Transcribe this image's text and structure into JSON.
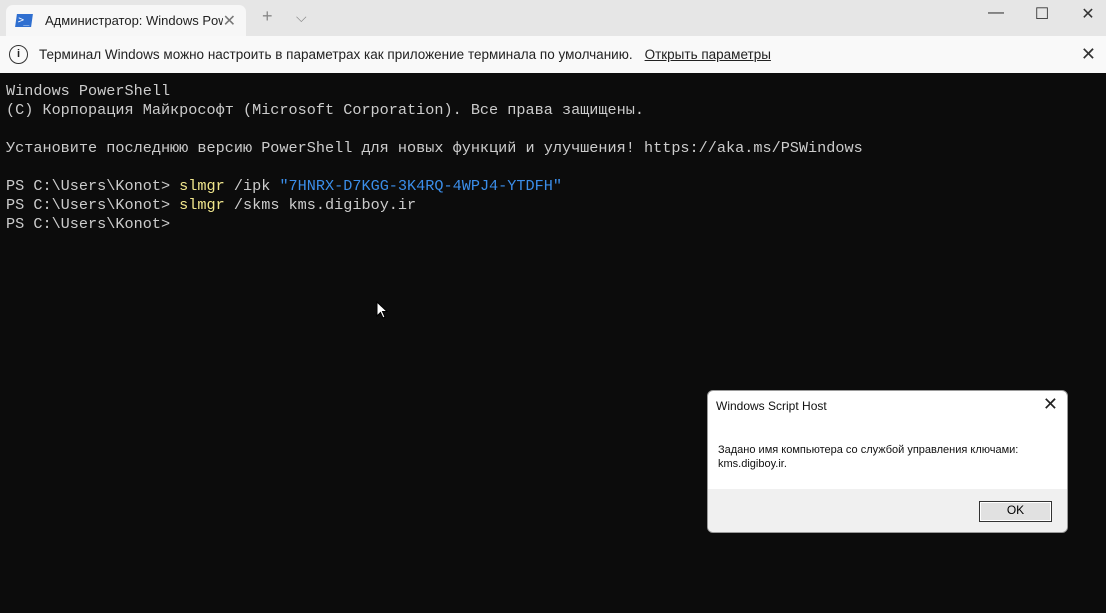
{
  "tab": {
    "title": "Администратор: Windows Pow",
    "close": "✕",
    "new": "+",
    "dropdown": "⌵"
  },
  "window": {
    "minimize": "—",
    "maximize": "☐",
    "close": "✕"
  },
  "infobar": {
    "icon": "i",
    "message": "Терминал Windows можно настроить в параметрах как приложение терминала по умолчанию.",
    "link": "Открыть параметры",
    "close": "✕"
  },
  "terminal": {
    "l1": "Windows PowerShell",
    "l2": "(С) Корпорация Майкрософт (Microsoft Corporation). Все права защищены.",
    "l3": "Установите последнюю версию PowerShell для новых функций и улучшения! https://aka.ms/PSWindows",
    "prompt": "PS C:\\Users\\Konot> ",
    "cmd1": "slmgr",
    "cmd1_args": " /ipk ",
    "cmd1_key": "\"7HNRX-D7KGG-3K4RQ-4WPJ4-YTDFH\"",
    "cmd2": "slmgr",
    "cmd2_args": " /skms kms.digiboy.ir"
  },
  "dialog": {
    "title": "Windows Script Host",
    "close": "✕",
    "line1": "Задано имя компьютера со службой управления ключами:",
    "line2": "kms.digiboy.ir.",
    "ok": "OK"
  },
  "colors": {
    "terminal_bg": "#0c0c0c",
    "command": "#f0e68c",
    "string": "#3b8eea"
  }
}
